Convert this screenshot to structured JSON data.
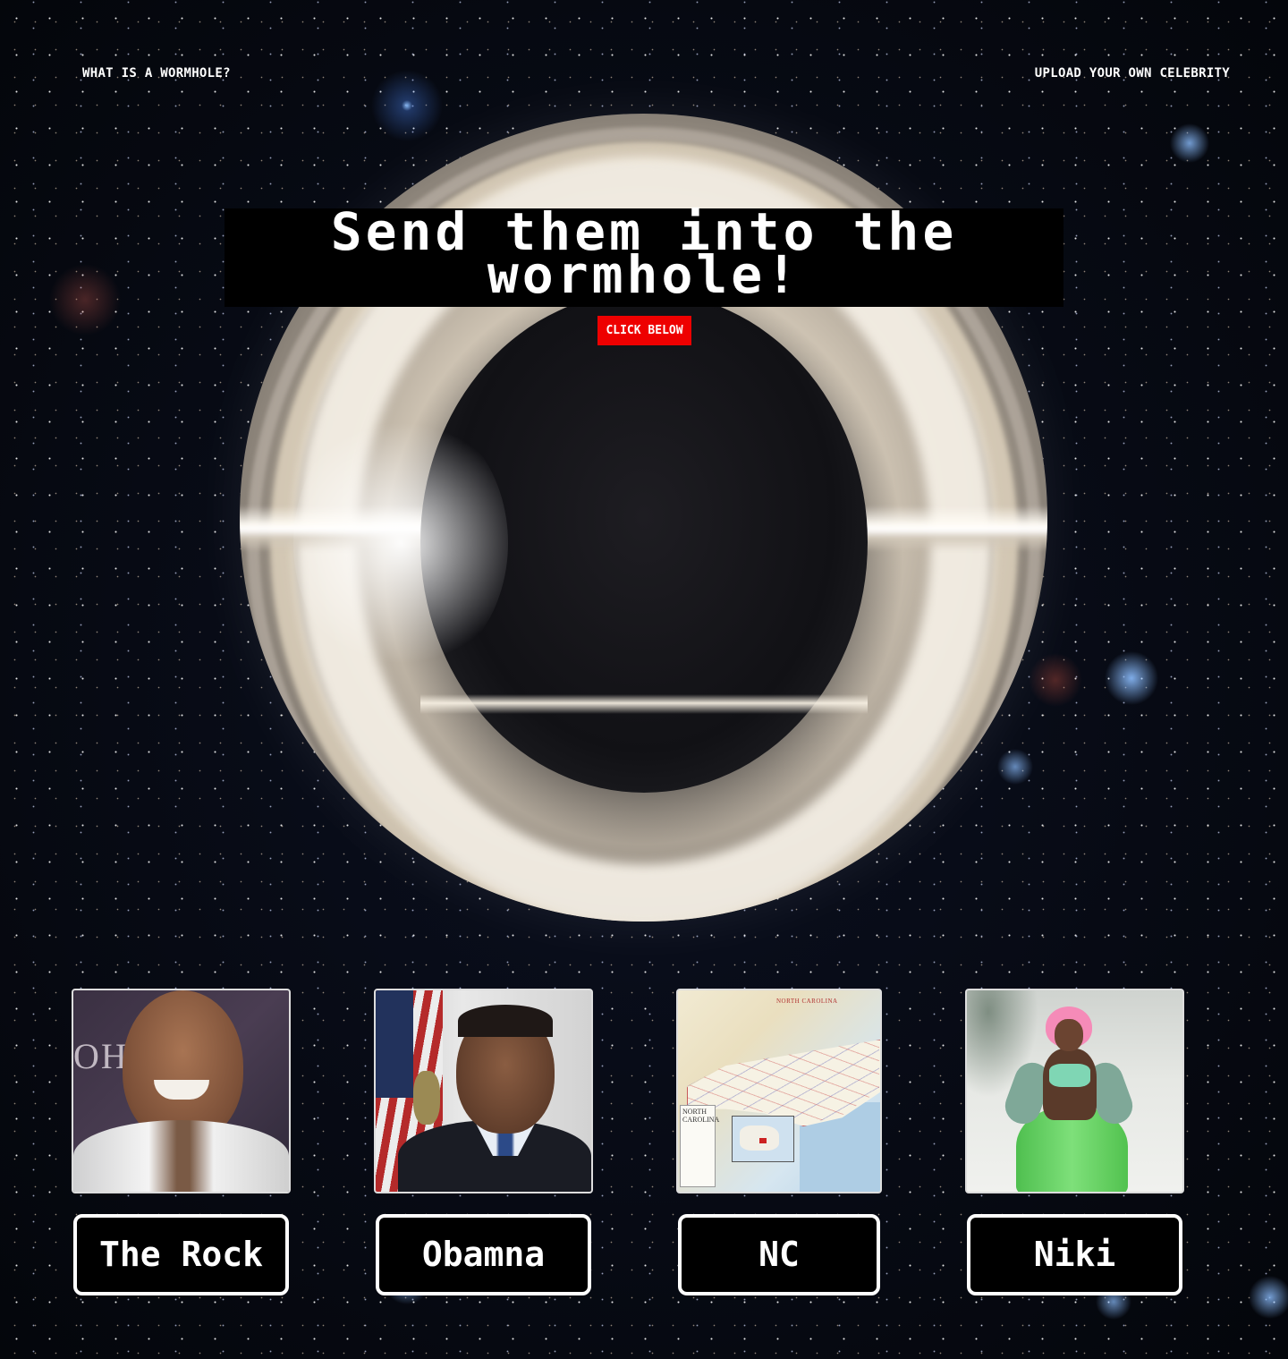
{
  "nav": {
    "left_link": "WHAT IS A WORMHOLE?",
    "right_link": "UPLOAD YOUR OWN CELEBRITY"
  },
  "hero": {
    "title_line1": "Send them into the",
    "title_line2": "wormhole!",
    "cta_label": "CLICK BELOW",
    "cta_color": "#ee0000"
  },
  "celebrities": [
    {
      "label": "The Rock",
      "image_alt": "The Rock"
    },
    {
      "label": "Obamna",
      "image_alt": "Obamna"
    },
    {
      "label": "NC",
      "image_alt": "NC"
    },
    {
      "label": "Niki",
      "image_alt": "Niki"
    }
  ],
  "nc_map": {
    "legend_text": "NORTH CAROLINA",
    "header_text": "NORTH CAROLINA"
  }
}
